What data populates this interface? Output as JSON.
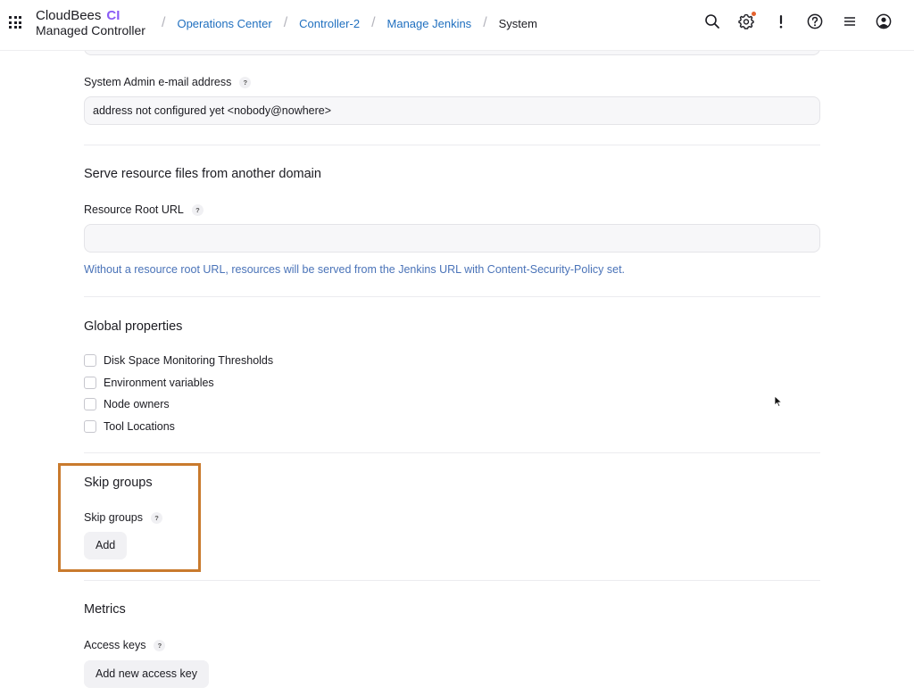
{
  "header": {
    "brand_name": "CloudBees",
    "brand_ci": "CI",
    "brand_subtitle": "Managed Controller",
    "breadcrumbs": [
      {
        "label": "Operations Center"
      },
      {
        "label": "Controller-2"
      },
      {
        "label": "Manage Jenkins"
      },
      {
        "label": "System"
      }
    ],
    "icons": [
      "search-icon",
      "settings-icon",
      "alert-icon",
      "help-icon",
      "menu-icon",
      "user-icon"
    ]
  },
  "admin_email": {
    "label": "System Admin e-mail address",
    "help": "?",
    "value": "address not configured yet <nobody@nowhere>"
  },
  "resource_root": {
    "section_title": "Serve resource files from another domain",
    "label": "Resource Root URL",
    "help": "?",
    "value": "",
    "hint": "Without a resource root URL, resources will be served from the Jenkins URL with Content-Security-Policy set."
  },
  "global_properties": {
    "section_title": "Global properties",
    "options": [
      {
        "label": "Disk Space Monitoring Thresholds",
        "checked": false
      },
      {
        "label": "Environment variables",
        "checked": false
      },
      {
        "label": "Node owners",
        "checked": false
      },
      {
        "label": "Tool Locations",
        "checked": false
      }
    ]
  },
  "skip_groups": {
    "section_title": "Skip groups",
    "label": "Skip groups",
    "help": "?",
    "add_button": "Add"
  },
  "metrics": {
    "section_title": "Metrics",
    "label": "Access keys",
    "help": "?",
    "add_button": "Add new access key"
  },
  "colors": {
    "accent_link": "#1f6fbf",
    "hint_text": "#4a73b8",
    "highlight_border": "#c97a2d",
    "ci_purple": "#8a5cf6",
    "notification_dot": "#e5622e"
  }
}
